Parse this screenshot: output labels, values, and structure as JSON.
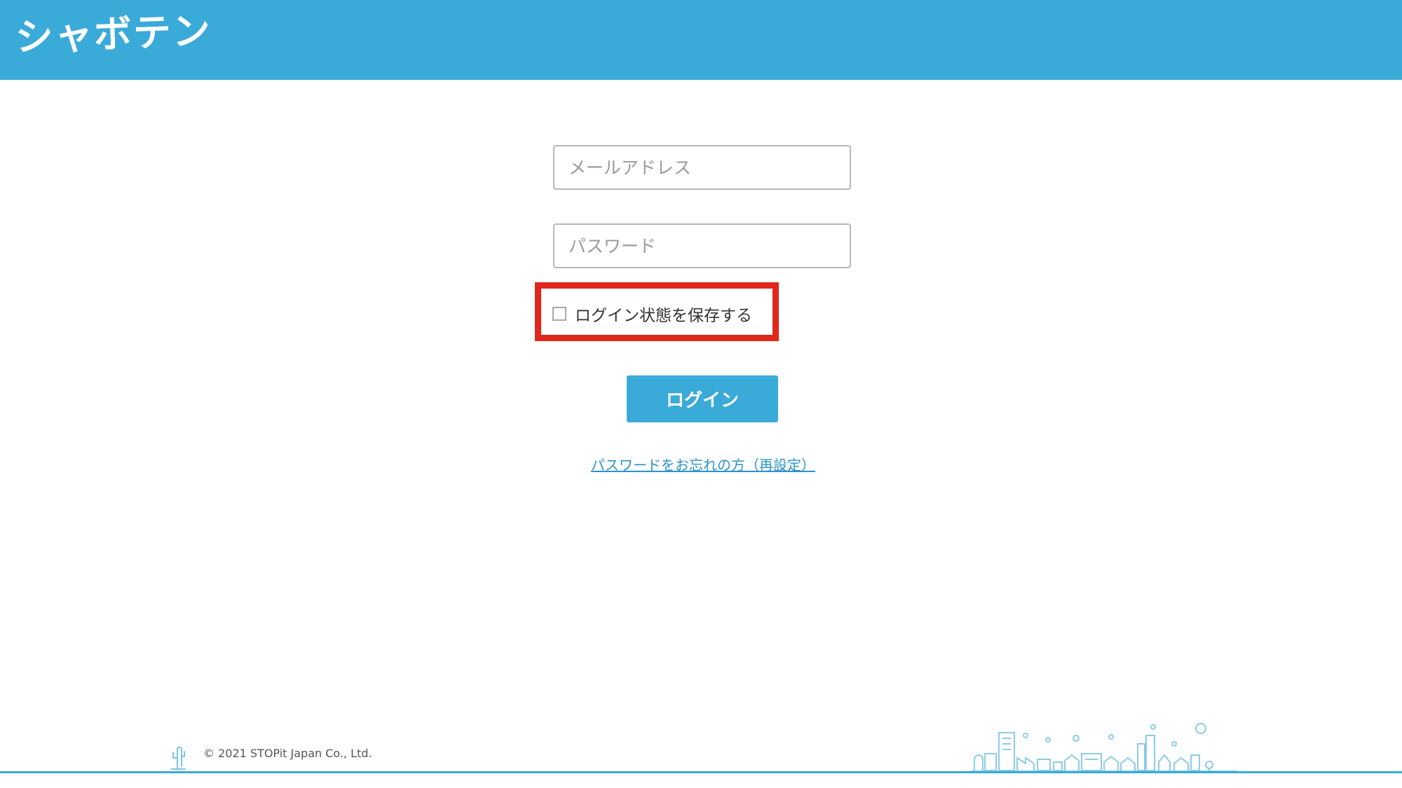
{
  "header": {
    "logo_text": "シャボテン",
    "background_color": "#3aaad9"
  },
  "form": {
    "email_placeholder": "メールアドレス",
    "password_placeholder": "パスワード",
    "remember_label": "ログイン状態を保存する",
    "remember_checked": false,
    "login_button_label": "ログイン",
    "forgot_link_text": "パスワードをお忘れの方（再設定）"
  },
  "annotation": {
    "highlight_color": "#e1261c"
  },
  "footer": {
    "copyright": "© 2021 STOPit Japan Co., Ltd.",
    "icons": [
      "cactus-icon",
      "city-skyline-icon"
    ]
  }
}
